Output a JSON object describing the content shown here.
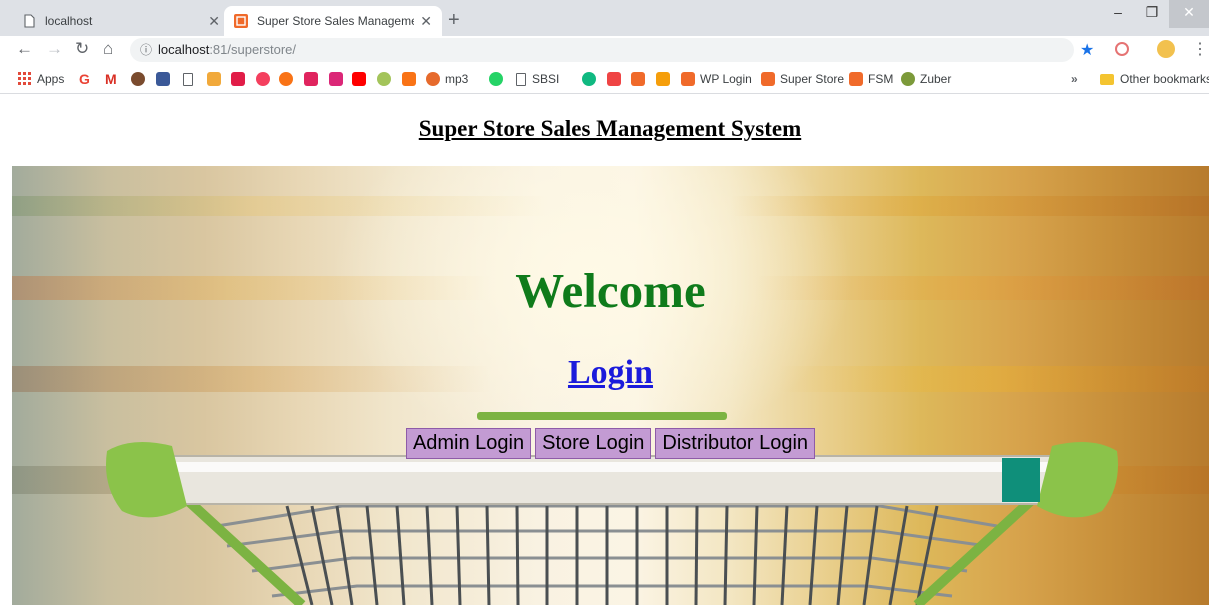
{
  "browser": {
    "tabs": [
      {
        "title": "localhost",
        "active": false
      },
      {
        "title": "Super Store Sales Management S",
        "active": true
      }
    ],
    "url_host": "localhost",
    "url_path": ":81/superstore/",
    "bookmarks": [
      {
        "label": "Apps",
        "icon": "apps-grid-icon",
        "color": "#4285f4"
      },
      {
        "label": "G",
        "icon": "google-icon",
        "color": "#ea4335"
      },
      {
        "label": "M",
        "icon": "gmail-icon",
        "color": "#d93025"
      },
      {
        "label": "mp3",
        "icon": "mp3-icon",
        "color": "#e66a2c"
      },
      {
        "label": "SBSI",
        "icon": "page-icon",
        "color": "#5f6368"
      },
      {
        "label": "WP Login",
        "icon": "superstore-icon",
        "color": "#f06a2a"
      },
      {
        "label": "Super Store",
        "icon": "superstore-icon",
        "color": "#f06a2a"
      },
      {
        "label": "FSM",
        "icon": "superstore-icon",
        "color": "#f06a2a"
      },
      {
        "label": "Zuber",
        "icon": "zuber-icon",
        "color": "#7c9a3a"
      },
      {
        "label": "»",
        "icon": "overflow-icon",
        "color": "#5f6368"
      },
      {
        "label": "Other bookmarks",
        "icon": "folder-icon",
        "color": "#f4c430"
      }
    ]
  },
  "page": {
    "header": "Super Store Sales Management System",
    "welcome": "Welcome",
    "login_link": "Login",
    "buttons": [
      "Admin Login",
      "Store Login",
      "Distributor Login"
    ],
    "colors": {
      "welcome": "#0f7b1b",
      "login_link": "#1b1bdb",
      "button_bg": "#c39bd3"
    }
  }
}
